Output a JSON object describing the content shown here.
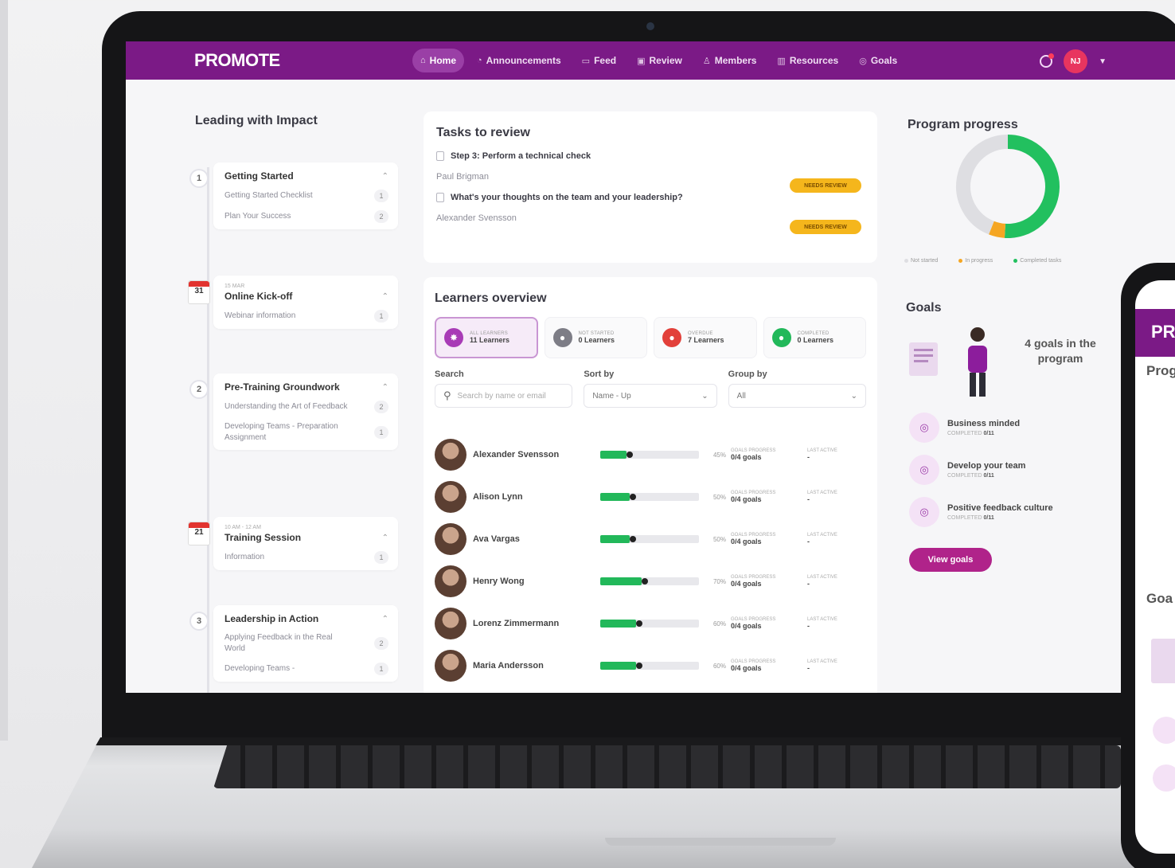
{
  "app": {
    "logo": "PROMOTE",
    "nav": [
      {
        "label": "Home",
        "icon": "home-icon",
        "glyph": "⌂"
      },
      {
        "label": "Announcements",
        "icon": "megaphone-icon",
        "glyph": "◔"
      },
      {
        "label": "Feed",
        "icon": "chat-icon",
        "glyph": "▭"
      },
      {
        "label": "Review",
        "icon": "review-icon",
        "glyph": "▣"
      },
      {
        "label": "Members",
        "icon": "members-icon",
        "glyph": "♙"
      },
      {
        "label": "Resources",
        "icon": "book-icon",
        "glyph": "▥"
      },
      {
        "label": "Goals",
        "icon": "goals-icon",
        "glyph": "◎"
      }
    ],
    "user_initials": "NJ",
    "accent": "#7b1a86"
  },
  "program": {
    "title": "Leading with Impact",
    "modules": [
      {
        "marker": "1",
        "kind": "step",
        "title": "Getting Started",
        "rows": [
          [
            "Getting Started Checklist",
            "1"
          ],
          [
            "Plan Your Success",
            "2"
          ]
        ]
      },
      {
        "marker": "31",
        "kind": "event",
        "sub": "15 MAR",
        "title": "Online Kick-off",
        "rows": [
          [
            "Webinar information",
            "1"
          ]
        ]
      },
      {
        "marker": "2",
        "kind": "step",
        "title": "Pre-Training Groundwork",
        "rows": [
          [
            "Understanding the Art of Feedback",
            "2"
          ],
          [
            "Developing Teams - Preparation Assignment",
            "1"
          ]
        ]
      },
      {
        "marker": "21",
        "kind": "event",
        "sub": "10 AM - 12 AM",
        "title": "Training Session",
        "rows": [
          [
            "Information",
            "1"
          ]
        ]
      },
      {
        "marker": "3",
        "kind": "step",
        "title": "Leadership in Action",
        "rows": [
          [
            "Applying Feedback in the Real World",
            "2"
          ],
          [
            "Developing Teams -",
            "1"
          ]
        ]
      }
    ]
  },
  "tasks": {
    "title": "Tasks to review",
    "items": [
      {
        "title": "Step 3: Perform a technical check",
        "person": "Paul Brigman",
        "badge": "NEEDS REVIEW"
      },
      {
        "title": "What's your thoughts on the team and your leadership?",
        "person": "Alexander Svensson",
        "badge": "NEEDS REVIEW"
      }
    ]
  },
  "learners": {
    "title": "Learners overview",
    "filters": [
      {
        "label": "ALL LEARNERS",
        "count": "11 Learners",
        "color": "#a83bb6",
        "glyph": "✸"
      },
      {
        "label": "NOT STARTED",
        "count": "0 Learners",
        "color": "#7d7d86",
        "glyph": "●"
      },
      {
        "label": "OVERDUE",
        "count": "7 Learners",
        "color": "#e2403a",
        "glyph": "●"
      },
      {
        "label": "COMPLETED",
        "count": "0 Learners",
        "color": "#22b85a",
        "glyph": "●"
      }
    ],
    "search_label": "Search",
    "search_placeholder": "Search by name or email",
    "sort_label": "Sort by",
    "sort_value": "Name - Up",
    "group_label": "Group by",
    "group_value": "All",
    "goals_progress_label": "GOALS PROGRESS",
    "last_active_label": "LAST ACTIVE",
    "rows": [
      {
        "name": "Alexander Svensson",
        "progress": 0.45,
        "pct": "45%",
        "goals": "0/4 goals",
        "last_active": "-"
      },
      {
        "name": "Alison Lynn",
        "progress": 0.5,
        "pct": "50%",
        "goals": "0/4 goals",
        "last_active": "-"
      },
      {
        "name": "Ava Vargas",
        "progress": 0.5,
        "pct": "50%",
        "goals": "0/4 goals",
        "last_active": "-"
      },
      {
        "name": "Henry Wong",
        "progress": 0.7,
        "pct": "70%",
        "goals": "0/4 goals",
        "last_active": "-"
      },
      {
        "name": "Lorenz Zimmermann",
        "progress": 0.6,
        "pct": "60%",
        "goals": "0/4 goals",
        "last_active": "-"
      },
      {
        "name": "Maria Andersson",
        "progress": 0.6,
        "pct": "60%",
        "goals": "0/4 goals",
        "last_active": "-"
      }
    ]
  },
  "progress": {
    "title": "Program progress",
    "segments": [
      {
        "name": "Not started",
        "value": 0.44,
        "color": "#dedee2"
      },
      {
        "name": "In progress",
        "value": 0.05,
        "color": "#f5a623"
      },
      {
        "name": "Completed tasks",
        "value": 0.51,
        "color": "#22c05f"
      }
    ]
  },
  "goals": {
    "title": "Goals",
    "summary": "4 goals in the program",
    "items": [
      {
        "name": "Business minded",
        "sub": "COMPLETED",
        "count": "0/11"
      },
      {
        "name": "Develop your team",
        "sub": "COMPLETED",
        "count": "0/11"
      },
      {
        "name": "Positive feedback culture",
        "sub": "COMPLETED",
        "count": "0/11"
      }
    ],
    "button": "View goals"
  },
  "phone": {
    "logo": "PR",
    "title": "Prog",
    "goals": "Goa"
  }
}
